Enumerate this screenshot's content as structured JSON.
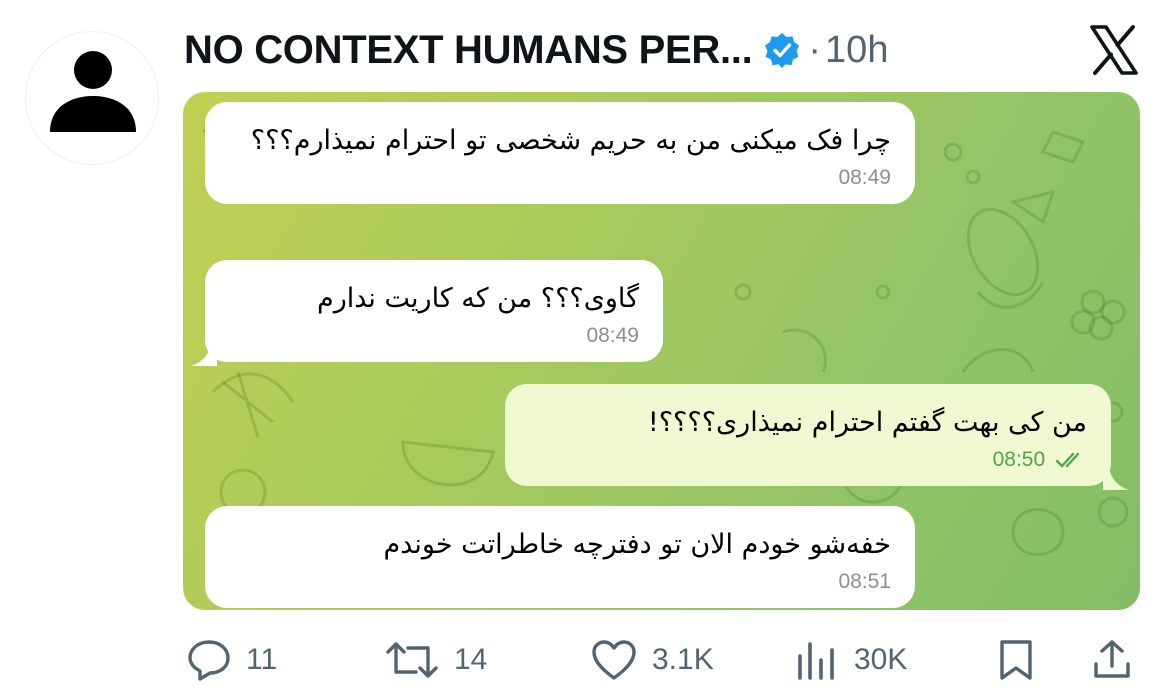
{
  "author": {
    "name": "NO CONTEXT HUMANS PER...",
    "verified": true,
    "separator": "·",
    "time": "10h"
  },
  "icons": {
    "avatar": "default-avatar-icon",
    "verified": "verified-badge-icon",
    "logo": "x-logo-icon",
    "reply": "reply-icon",
    "repost": "repost-icon",
    "like": "heart-icon",
    "views": "views-icon",
    "bookmark": "bookmark-icon",
    "share": "share-icon"
  },
  "media": {
    "messages": [
      {
        "direction": "incoming",
        "text": "چرا فک میکنی من به حریم شخصی تو احترام نمیذارم؟؟؟",
        "time": "08:49"
      },
      {
        "direction": "incoming",
        "text": "گاوی؟؟؟ من که کاریت ندارم",
        "time": "08:49"
      },
      {
        "direction": "outgoing",
        "text": "من کی بهت گفتم احترام نمیذاری؟؟؟؟!",
        "time": "08:50",
        "read": true
      },
      {
        "direction": "incoming",
        "text": "خفه‌شو خودم الان تو دفترچه خاطراتت خوندم",
        "time": "08:51"
      }
    ]
  },
  "actions": {
    "replies": "11",
    "reposts": "14",
    "likes": "3.1K",
    "views": "30K"
  },
  "colors": {
    "accent_blue": "#1d9bf0",
    "muted_text": "#536471",
    "chat_bg_start": "#c2cf53",
    "chat_bg_end": "#82be66",
    "outgoing_bubble": "#eff8d0",
    "read_check": "#55a349"
  }
}
